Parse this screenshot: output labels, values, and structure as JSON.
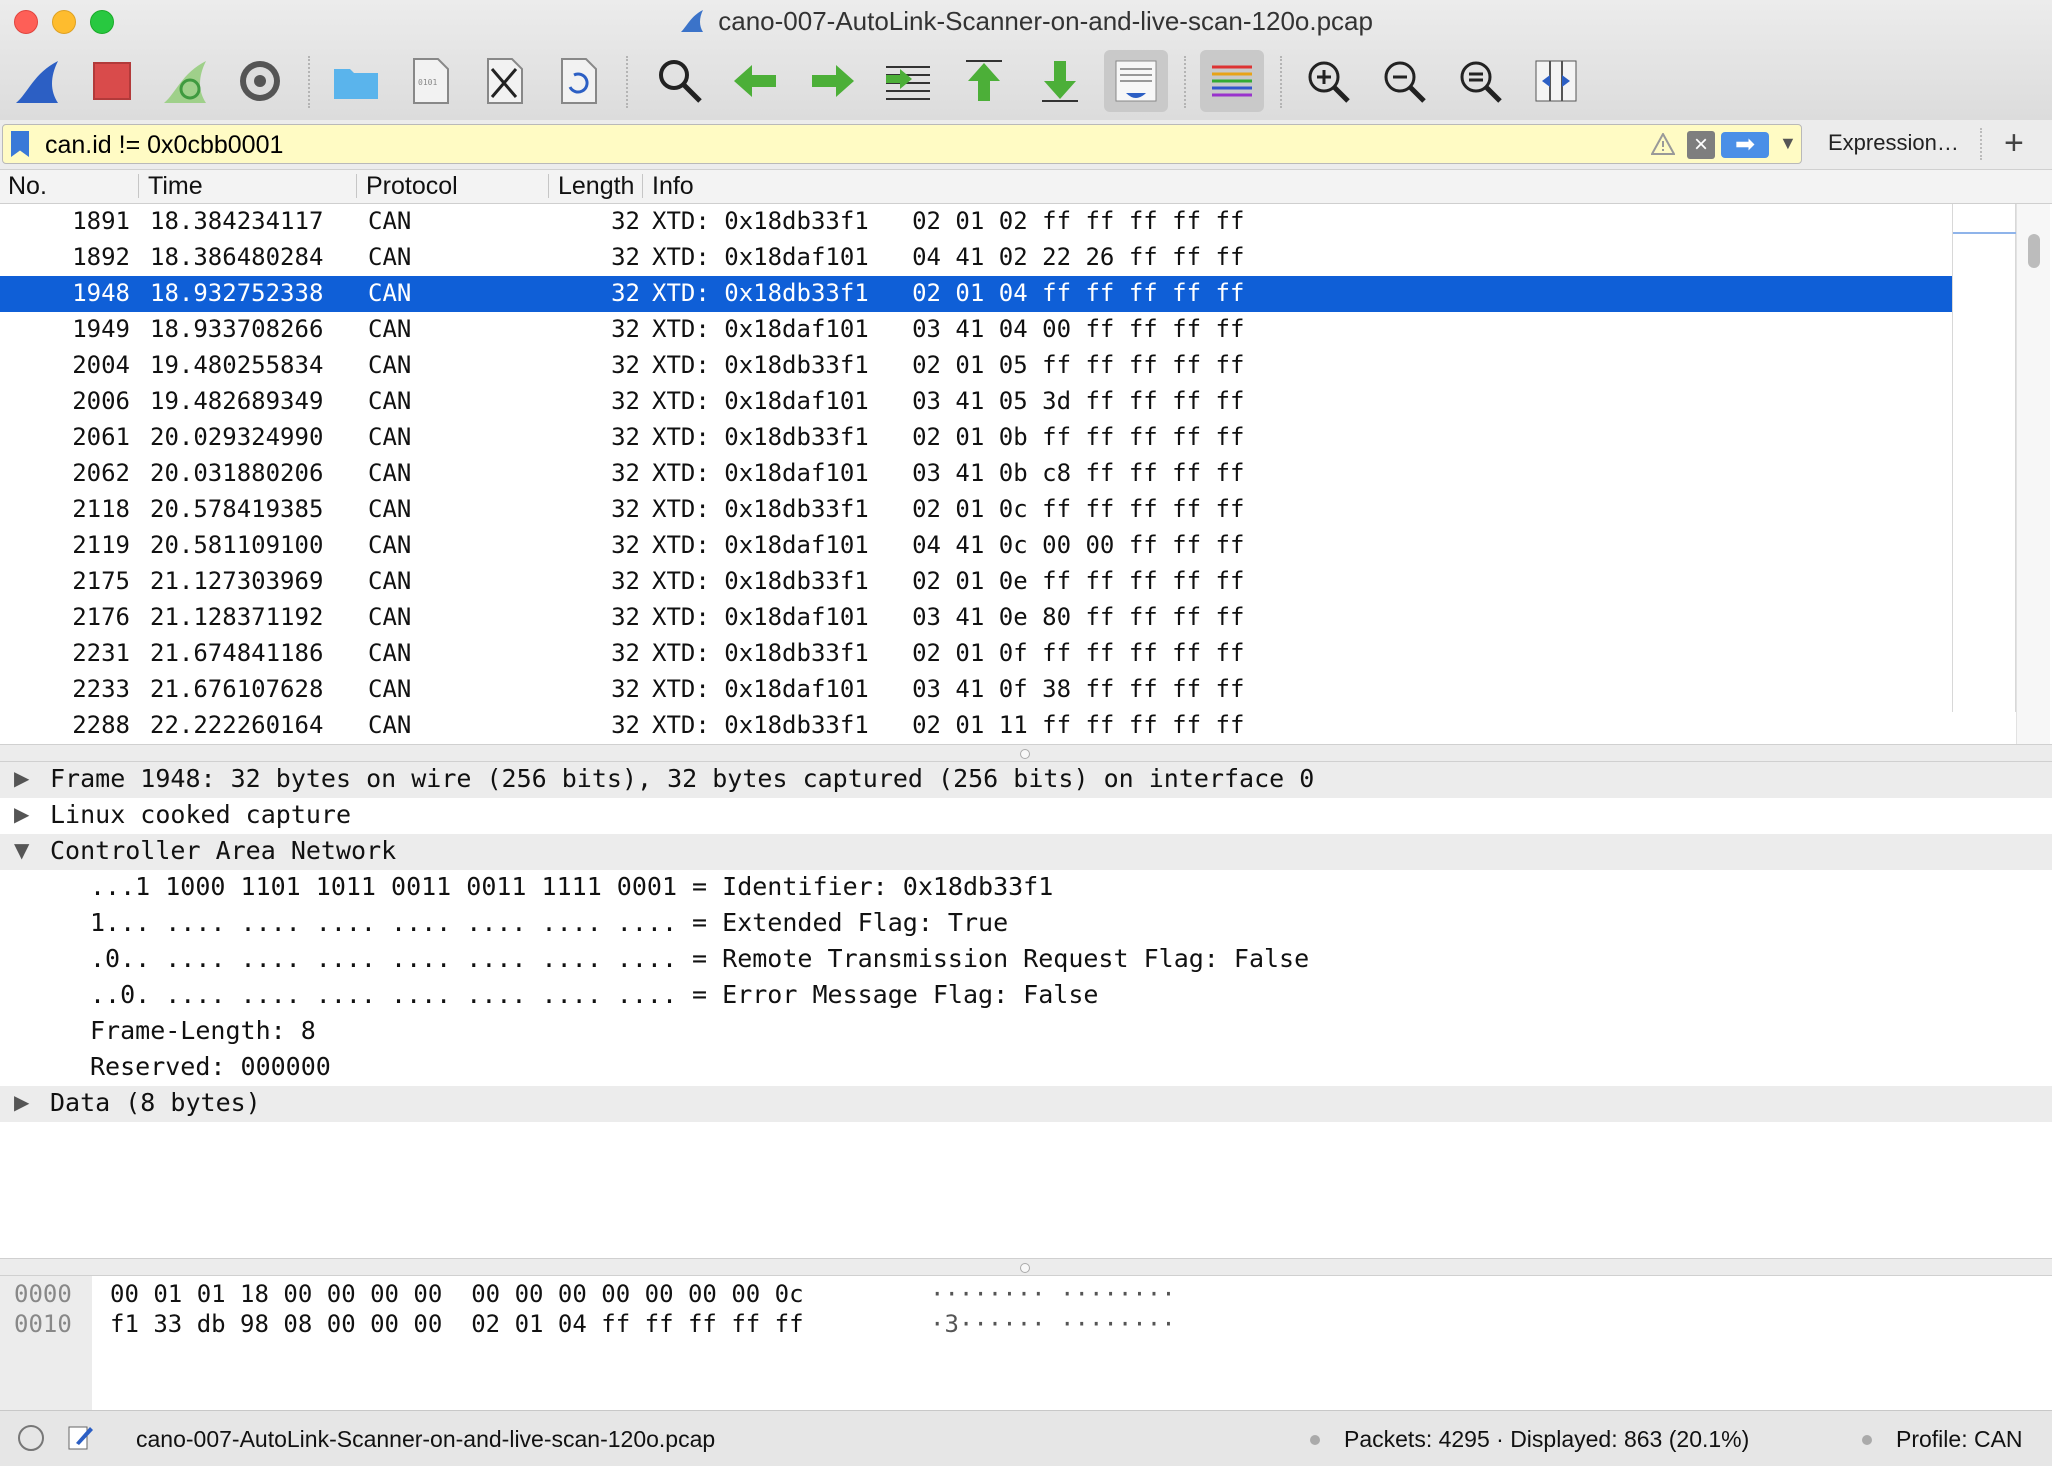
{
  "window": {
    "title": "cano-007-AutoLink-Scanner-on-and-live-scan-120o.pcap"
  },
  "toolbar": {
    "buttons": [
      "start-capture",
      "stop-capture",
      "restart-capture",
      "capture-options",
      "open-file",
      "file-properties",
      "close-file",
      "reload-file",
      "find-packet",
      "go-back",
      "go-forward",
      "go-to-packet",
      "go-first",
      "go-last",
      "autoscroll",
      "colorize",
      "zoom-in",
      "zoom-out",
      "zoom-reset",
      "resize-columns"
    ]
  },
  "filter": {
    "value": "can.id != 0x0cbb0001",
    "expression_label": "Expression…",
    "add_label": "+"
  },
  "packet_list": {
    "columns": [
      "No.",
      "Time",
      "Protocol",
      "Length",
      "Info"
    ],
    "rows": [
      {
        "no": "1891",
        "time": "18.384234117",
        "protocol": "CAN",
        "length": "32",
        "info": "XTD: 0x18db33f1   02 01 02 ff ff ff ff ff"
      },
      {
        "no": "1892",
        "time": "18.386480284",
        "protocol": "CAN",
        "length": "32",
        "info": "XTD: 0x18daf101   04 41 02 22 26 ff ff ff"
      },
      {
        "no": "1948",
        "time": "18.932752338",
        "protocol": "CAN",
        "length": "32",
        "info": "XTD: 0x18db33f1   02 01 04 ff ff ff ff ff",
        "selected": true
      },
      {
        "no": "1949",
        "time": "18.933708266",
        "protocol": "CAN",
        "length": "32",
        "info": "XTD: 0x18daf101   03 41 04 00 ff ff ff ff"
      },
      {
        "no": "2004",
        "time": "19.480255834",
        "protocol": "CAN",
        "length": "32",
        "info": "XTD: 0x18db33f1   02 01 05 ff ff ff ff ff"
      },
      {
        "no": "2006",
        "time": "19.482689349",
        "protocol": "CAN",
        "length": "32",
        "info": "XTD: 0x18daf101   03 41 05 3d ff ff ff ff"
      },
      {
        "no": "2061",
        "time": "20.029324990",
        "protocol": "CAN",
        "length": "32",
        "info": "XTD: 0x18db33f1   02 01 0b ff ff ff ff ff"
      },
      {
        "no": "2062",
        "time": "20.031880206",
        "protocol": "CAN",
        "length": "32",
        "info": "XTD: 0x18daf101   03 41 0b c8 ff ff ff ff"
      },
      {
        "no": "2118",
        "time": "20.578419385",
        "protocol": "CAN",
        "length": "32",
        "info": "XTD: 0x18db33f1   02 01 0c ff ff ff ff ff"
      },
      {
        "no": "2119",
        "time": "20.581109100",
        "protocol": "CAN",
        "length": "32",
        "info": "XTD: 0x18daf101   04 41 0c 00 00 ff ff ff"
      },
      {
        "no": "2175",
        "time": "21.127303969",
        "protocol": "CAN",
        "length": "32",
        "info": "XTD: 0x18db33f1   02 01 0e ff ff ff ff ff"
      },
      {
        "no": "2176",
        "time": "21.128371192",
        "protocol": "CAN",
        "length": "32",
        "info": "XTD: 0x18daf101   03 41 0e 80 ff ff ff ff"
      },
      {
        "no": "2231",
        "time": "21.674841186",
        "protocol": "CAN",
        "length": "32",
        "info": "XTD: 0x18db33f1   02 01 0f ff ff ff ff ff"
      },
      {
        "no": "2233",
        "time": "21.676107628",
        "protocol": "CAN",
        "length": "32",
        "info": "XTD: 0x18daf101   03 41 0f 38 ff ff ff ff"
      },
      {
        "no": "2288",
        "time": "22.222260164",
        "protocol": "CAN",
        "length": "32",
        "info": "XTD: 0x18db33f1   02 01 11 ff ff ff ff ff"
      }
    ]
  },
  "details": {
    "rows": [
      {
        "text": "Frame 1948: 32 bytes on wire (256 bits), 32 bytes captured (256 bits) on interface 0",
        "arrow": "▶",
        "indent": 0,
        "highlight": true
      },
      {
        "text": "Linux cooked capture",
        "arrow": "▶",
        "indent": 0,
        "highlight": false
      },
      {
        "text": "Controller Area Network",
        "arrow": "▼",
        "indent": 0,
        "highlight": true
      },
      {
        "text": "...1 1000 1101 1011 0011 0011 1111 0001 = Identifier: 0x18db33f1",
        "arrow": "",
        "indent": 1,
        "highlight": false
      },
      {
        "text": "1... .... .... .... .... .... .... .... = Extended Flag: True",
        "arrow": "",
        "indent": 1,
        "highlight": false
      },
      {
        "text": ".0.. .... .... .... .... .... .... .... = Remote Transmission Request Flag: False",
        "arrow": "",
        "indent": 1,
        "highlight": false
      },
      {
        "text": "..0. .... .... .... .... .... .... .... = Error Message Flag: False",
        "arrow": "",
        "indent": 1,
        "highlight": false
      },
      {
        "text": "Frame-Length: 8",
        "arrow": "",
        "indent": 1,
        "highlight": false
      },
      {
        "text": "Reserved: 000000",
        "arrow": "",
        "indent": 1,
        "highlight": false
      },
      {
        "text": "Data (8 bytes)",
        "arrow": "▶",
        "indent": 0,
        "highlight": true
      }
    ]
  },
  "bytes": {
    "rows": [
      {
        "offset": "0000",
        "hex": "00 01 01 18 00 00 00 00  00 00 00 00 00 00 00 0c",
        "ascii": "········ ········"
      },
      {
        "offset": "0010",
        "hex": "f1 33 db 98 08 00 00 00  02 01 04 ff ff ff ff ff",
        "ascii": "·3······ ········"
      }
    ]
  },
  "status": {
    "file": "cano-007-AutoLink-Scanner-on-and-live-scan-120o.pcap",
    "packets": "Packets: 4295 · Displayed: 863 (20.1%)",
    "profile": "Profile: CAN"
  },
  "colors": {
    "selection": "#0f5fd7",
    "filter_background": "#fffbc4"
  }
}
